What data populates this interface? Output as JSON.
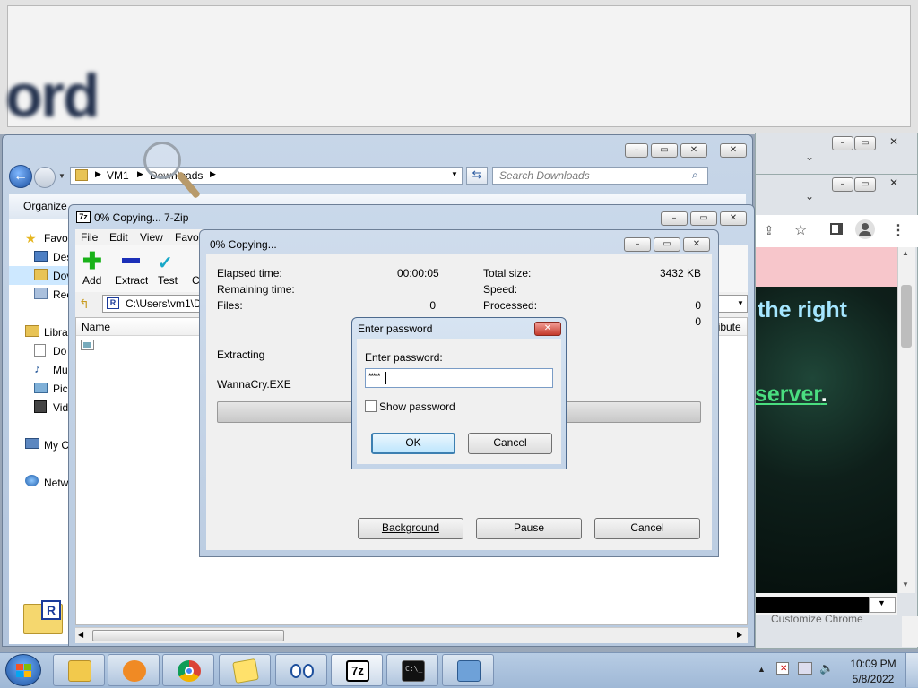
{
  "background": {
    "blur_text": "ord"
  },
  "explorer": {
    "breadcrumb": [
      "VM1",
      "Downloads"
    ],
    "search_placeholder": "Search Downloads",
    "organize": "Organize",
    "nav": [
      "Favo",
      "Des",
      "Dov",
      "Rec",
      "Libra",
      "Do",
      "Mu",
      "Pic",
      "Vid",
      "My C",
      "Netw"
    ]
  },
  "zip": {
    "title": "0% Copying... 7-Zip",
    "menu": [
      "File",
      "Edit",
      "View",
      "Favo"
    ],
    "toolbar": [
      {
        "label": "Add",
        "icon": "add-icon"
      },
      {
        "label": "Extract",
        "icon": "extract-icon"
      },
      {
        "label": "Test",
        "icon": "test-icon"
      },
      {
        "label": "C",
        "icon": "copy-icon"
      }
    ],
    "path": "C:\\Users\\vm1\\D",
    "columns": {
      "name": "Name",
      "attributes": "ttribute"
    }
  },
  "progress": {
    "title": "0% Copying...",
    "elapsed_label": "Elapsed time:",
    "elapsed_value": "00:00:05",
    "remaining_label": "Remaining time:",
    "files_label": "Files:",
    "files_value": "0",
    "total_label": "Total size:",
    "total_value": "3432 KB",
    "speed_label": "Speed:",
    "processed_label": "Processed:",
    "processed_value": "0",
    "extra_value": "0",
    "status": "Extracting",
    "filename": "WannaCry.EXE",
    "percent": 0,
    "buttons": {
      "background": "Background",
      "pause": "Pause",
      "cancel": "Cancel"
    }
  },
  "password_dialog": {
    "title": "Enter password",
    "label": "Enter password:",
    "masked_value": "*****",
    "show_password": "Show password",
    "ok": "OK",
    "cancel": "Cancel"
  },
  "chrome": {
    "line1": "the right",
    "line2": "server",
    "line2_tail": ".",
    "bottom_label": "Customize Chrome"
  },
  "taskbar": {
    "time": "10:09 PM",
    "date": "5/8/2022",
    "apps": [
      "windows-explorer",
      "media-player",
      "chrome",
      "folder",
      "eyes",
      "7-zip",
      "cmd",
      "network-tool"
    ]
  },
  "colors": {
    "accent_green": "#4ade80",
    "link_cyan": "#7dd3fc",
    "pink_banner": "#f7c6cb"
  }
}
